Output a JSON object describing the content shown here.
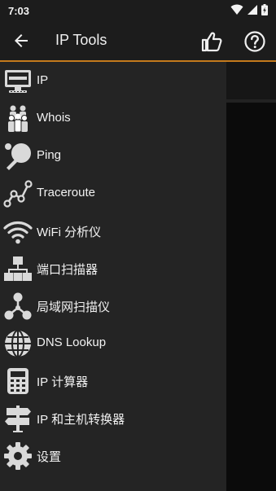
{
  "status": {
    "time": "7:03"
  },
  "app_bar": {
    "title": "IP Tools"
  },
  "menu": [
    {
      "label": "IP",
      "icon": "monitor-icon"
    },
    {
      "label": "Whois",
      "icon": "people-icon"
    },
    {
      "label": "Ping",
      "icon": "ping-pong-icon"
    },
    {
      "label": "Traceroute",
      "icon": "route-icon"
    },
    {
      "label": "WiFi 分析仪",
      "icon": "wifi-icon"
    },
    {
      "label": "端口扫描器",
      "icon": "port-network-icon"
    },
    {
      "label": "局域网扫描仪",
      "icon": "lan-network-icon"
    },
    {
      "label": "DNS Lookup",
      "icon": "globe-icon"
    },
    {
      "label": "IP 计算器",
      "icon": "calculator-icon"
    },
    {
      "label": "IP 和主机转换器",
      "icon": "signpost-icon"
    },
    {
      "label": "设置",
      "icon": "gear-icon"
    }
  ],
  "colors": {
    "accent": "#c47a1c",
    "drawer": "#242424",
    "appbar": "#1c1c1c"
  }
}
